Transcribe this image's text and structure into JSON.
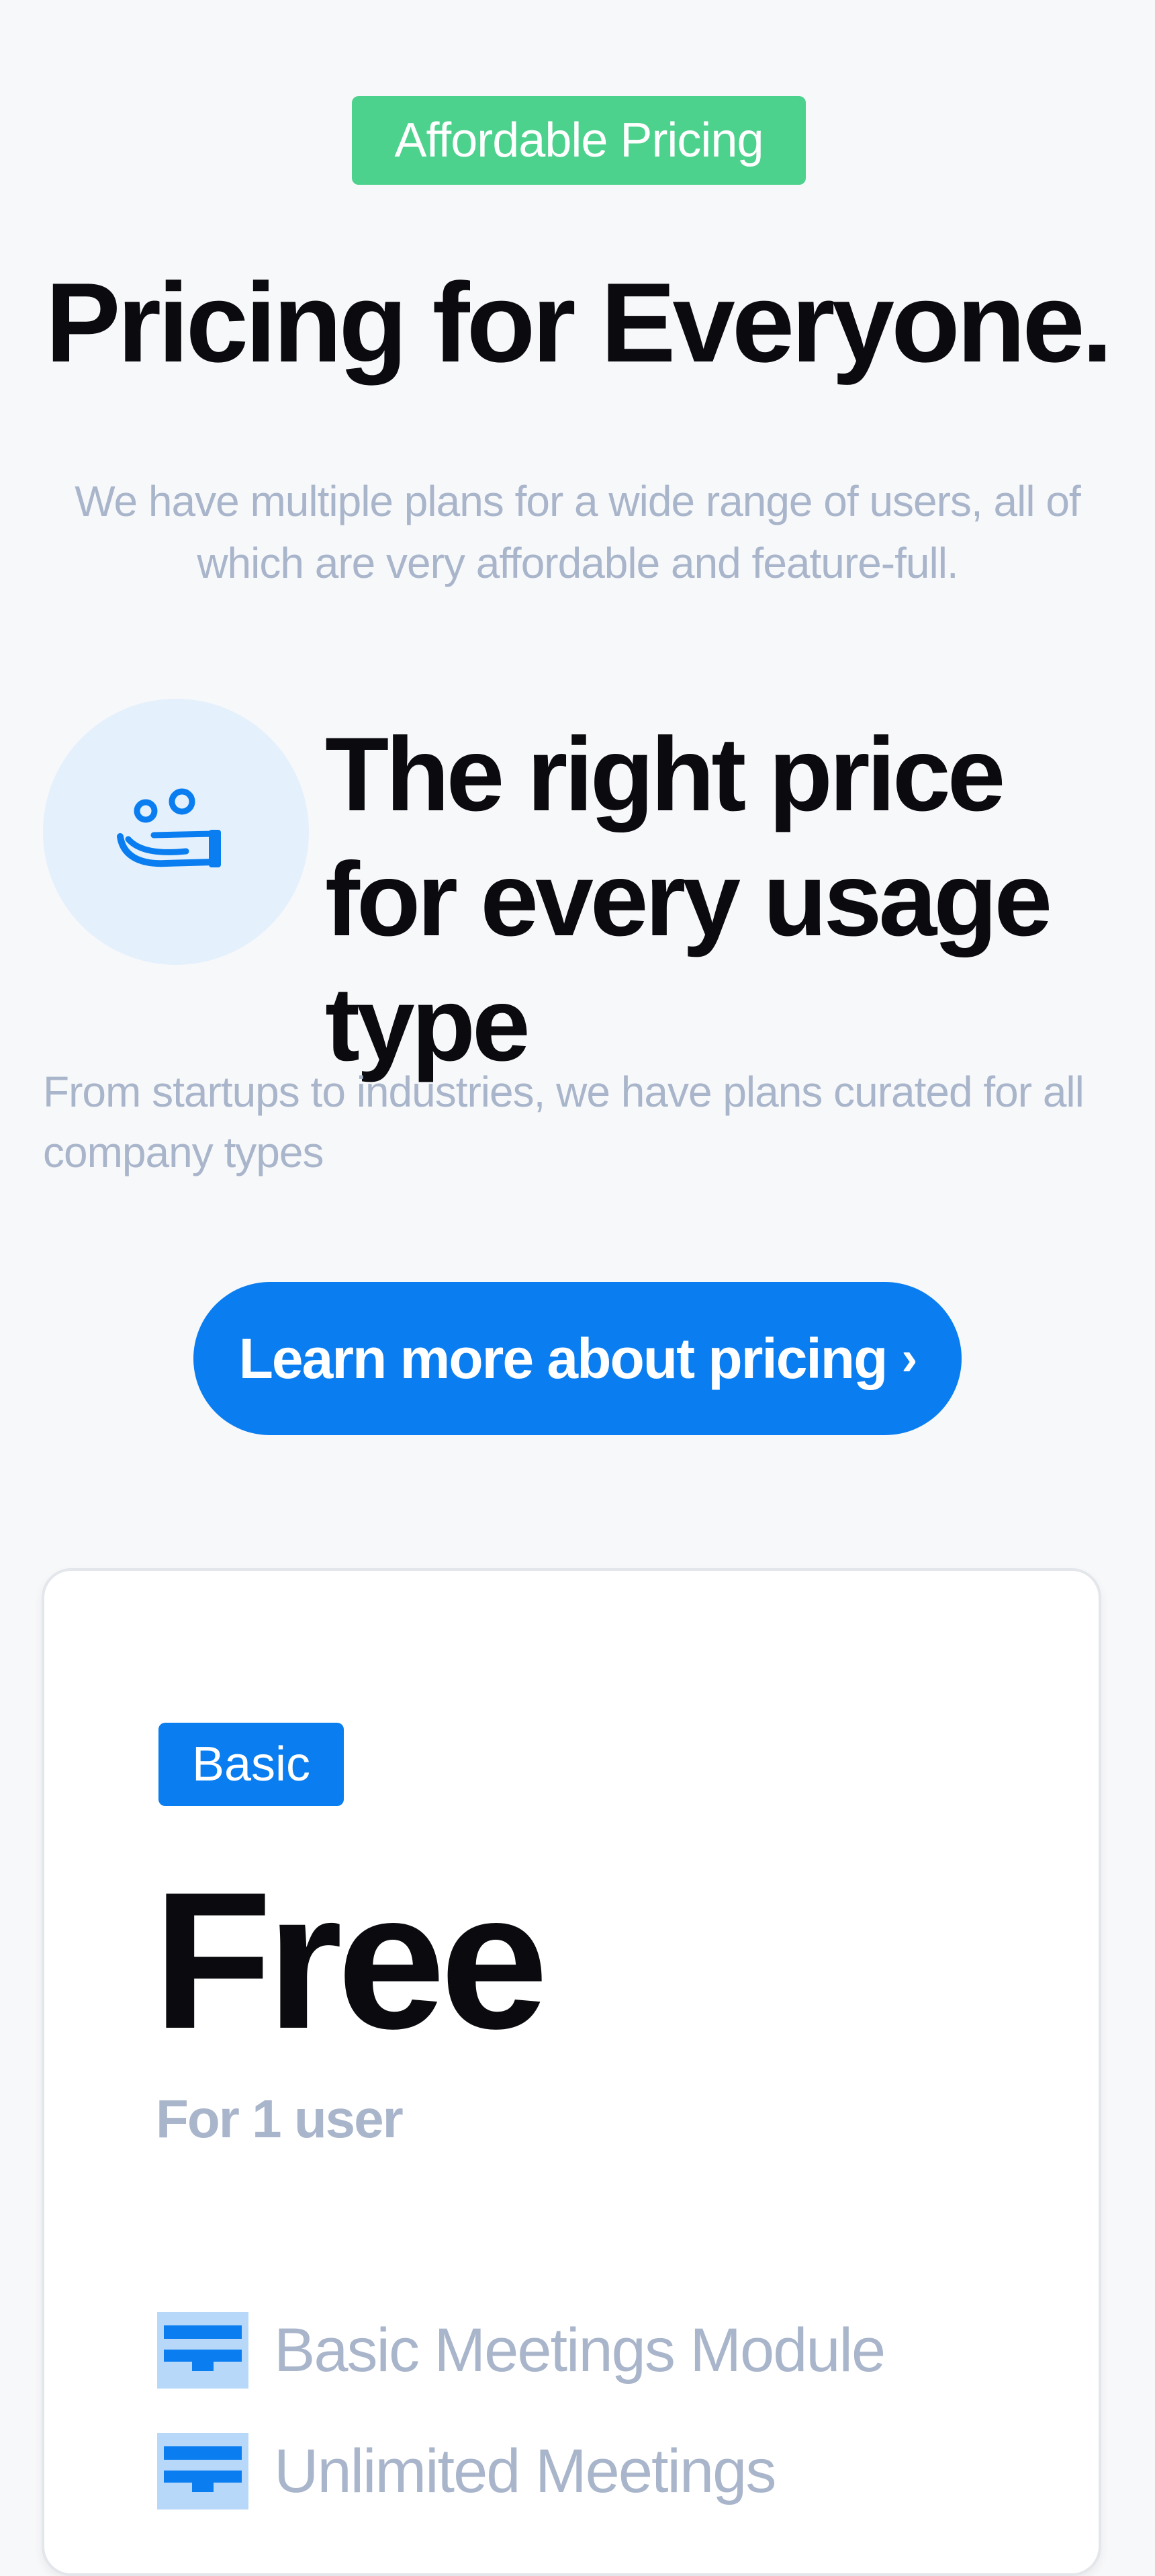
{
  "badge": {
    "label": "Affordable Pricing"
  },
  "hero": {
    "title": "Pricing for Everyone.",
    "subtitle": "We have multiple plans for a wide range of users, all of which are very affordable and feature-full."
  },
  "feature": {
    "icon": "hand-with-people-icon",
    "title": "The right price for every usage type",
    "subtitle": "From startups to industries, we have plans curated for all company types"
  },
  "cta": {
    "label": "Learn more about pricing",
    "chevron": "›"
  },
  "plan": {
    "tag": "Basic",
    "price": "Free",
    "users": "For 1 user",
    "features": [
      {
        "icon": "meetings-module-icon",
        "label": "Basic Meetings Module"
      },
      {
        "icon": "meetings-module-icon",
        "label": "Unlimited Meetings"
      }
    ]
  },
  "colors": {
    "accent": "#0a7ef0",
    "badge_green": "#4cd28c",
    "muted_text": "#a9b5ca",
    "icon_circle": "#e4f0fc"
  }
}
